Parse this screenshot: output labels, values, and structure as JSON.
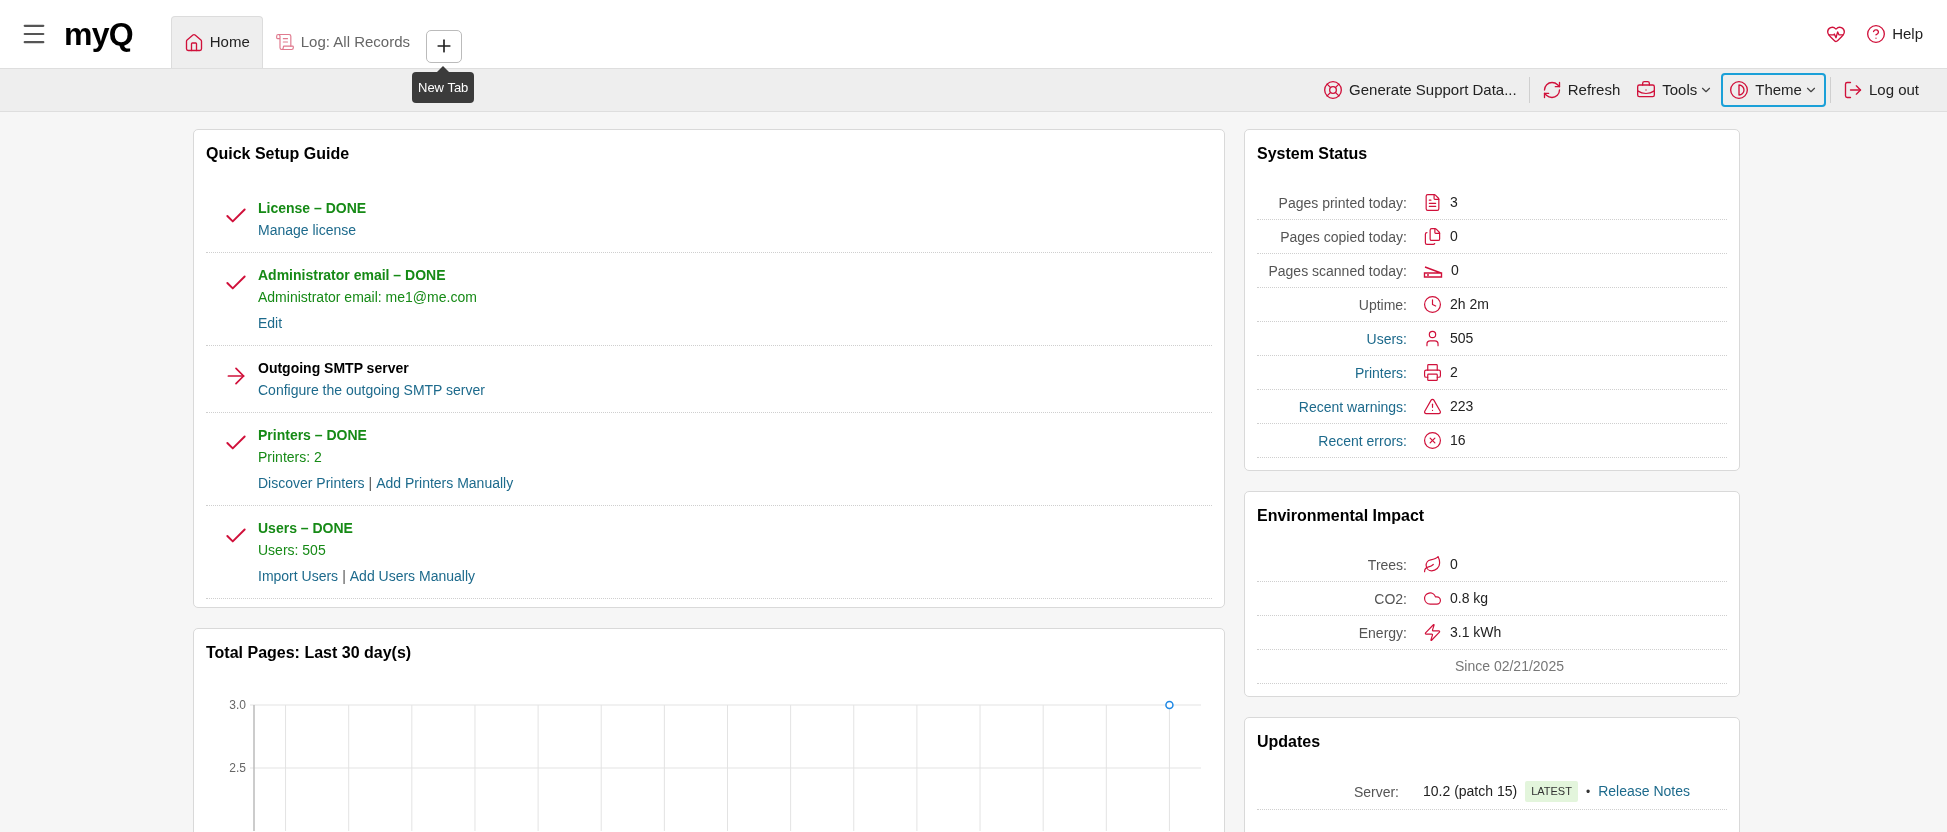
{
  "header": {
    "logo": "myQ",
    "tabs": [
      {
        "label": "Home",
        "selected": true
      },
      {
        "label": "Log: All Records",
        "selected": false
      }
    ],
    "new_tab_tooltip": "New Tab",
    "help": "Help"
  },
  "toolbar": [
    {
      "label": "Generate Support Data...",
      "dropdown": false,
      "focused": false,
      "separator_before": false
    },
    {
      "label": "Refresh",
      "dropdown": false,
      "focused": false,
      "separator_before": true
    },
    {
      "label": "Tools",
      "dropdown": true,
      "focused": false,
      "separator_before": false
    },
    {
      "label": "Theme",
      "dropdown": true,
      "focused": true,
      "separator_before": false
    },
    {
      "label": "Log out",
      "dropdown": false,
      "focused": false,
      "separator_before": true
    }
  ],
  "quick_setup": {
    "title": "Quick Setup Guide",
    "steps": [
      {
        "title": "License – DONE",
        "done": true,
        "links": [
          "Manage license"
        ]
      },
      {
        "title": "Administrator email – DONE",
        "done": true,
        "detail": "Administrator email: me1@me.com",
        "links": [
          "Edit"
        ]
      },
      {
        "title": "Outgoing SMTP server",
        "done": false,
        "links": [
          "Configure the outgoing SMTP server"
        ]
      },
      {
        "title": "Printers – DONE",
        "done": true,
        "detail": "Printers: 2",
        "links": [
          "Discover Printers",
          "Add Printers Manually"
        ],
        "separator": "|"
      },
      {
        "title": "Users – DONE",
        "done": true,
        "detail": "Users: 505",
        "links": [
          "Import Users",
          "Add Users Manually"
        ],
        "separator": "|"
      }
    ]
  },
  "total_pages": {
    "title": "Total Pages: Last 30 day(s)",
    "chart_data": {
      "type": "line",
      "ylim": [
        2,
        3
      ],
      "grid": true,
      "yticks": [
        {
          "value": 3,
          "label": "3.0"
        },
        {
          "value": 2.5,
          "label": "2.5"
        }
      ],
      "series": [
        {
          "color": "#1e88e5",
          "marker": true,
          "values": [
            null,
            null,
            null,
            null,
            null,
            null,
            null,
            null,
            null,
            null,
            null,
            null,
            null,
            null,
            3
          ]
        }
      ]
    }
  },
  "system_status": {
    "title": "System Status",
    "rows": [
      {
        "label": "Pages printed today:",
        "value": "3",
        "link": false
      },
      {
        "label": "Pages copied today:",
        "value": "0",
        "link": false
      },
      {
        "label": "Pages scanned today:",
        "value": "0",
        "link": false
      },
      {
        "label": "Uptime:",
        "value": "2h 2m",
        "link": false
      },
      {
        "label": "Users:",
        "value": "505",
        "link": true
      },
      {
        "label": "Printers:",
        "value": "2",
        "link": true
      },
      {
        "label": "Recent warnings:",
        "value": "223",
        "link": true
      },
      {
        "label": "Recent errors:",
        "value": "16",
        "link": true
      }
    ]
  },
  "environmental_impact": {
    "title": "Environmental Impact",
    "rows": [
      {
        "label": "Trees:",
        "value": "0"
      },
      {
        "label": "CO2:",
        "value": "0.8 kg"
      },
      {
        "label": "Energy:",
        "value": "3.1 kWh"
      }
    ],
    "since": "Since 02/21/2025"
  },
  "updates": {
    "title": "Updates",
    "rows": [
      {
        "label": "Server:",
        "value": "10.2 (patch 15)",
        "badge": "LATEST",
        "bullet": "•",
        "link": "Release Notes"
      }
    ]
  }
}
